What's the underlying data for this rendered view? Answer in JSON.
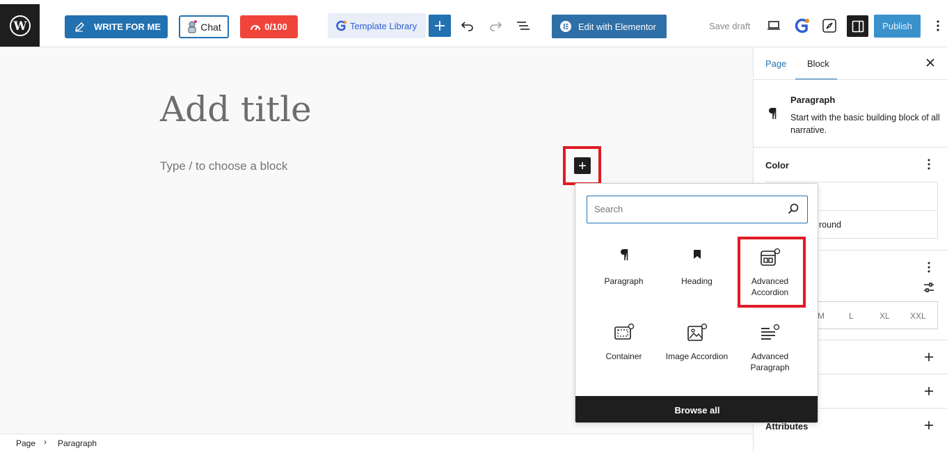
{
  "toolbar": {
    "write_label": "WRITE FOR ME",
    "chat_label": "Chat",
    "score_label": "0/100",
    "template_label": "Template Library",
    "elementor_label": "Edit with Elementor",
    "save_draft_label": "Save draft",
    "publish_label": "Publish"
  },
  "editor": {
    "title_placeholder": "Add title",
    "block_placeholder": "Type / to choose a block"
  },
  "inserter": {
    "search_placeholder": "Search",
    "blocks": [
      {
        "label": "Paragraph",
        "icon": "paragraph-icon"
      },
      {
        "label": "Heading",
        "icon": "bookmark-icon"
      },
      {
        "label": "Advanced Accordion",
        "icon": "accordion-icon"
      },
      {
        "label": "Container",
        "icon": "container-icon"
      },
      {
        "label": "Image Accordion",
        "icon": "image-accordion-icon"
      },
      {
        "label": "Advanced Paragraph",
        "icon": "advanced-paragraph-icon"
      }
    ],
    "browse_all_label": "Browse all"
  },
  "sidebar": {
    "tab_page": "Page",
    "tab_block": "Block",
    "block_name": "Paragraph",
    "block_description": "Start with the basic building block of all narrative.",
    "color_title": "Color",
    "color_background_fragment": "round",
    "sizes": [
      "M",
      "L",
      "XL",
      "XXL"
    ],
    "attributes_title": "Attributes"
  },
  "footer": {
    "crumb_page": "Page",
    "crumb_current": "Paragraph"
  },
  "colors": {
    "accent": "#2271b1",
    "highlight": "#e01b24",
    "score": "#f0443a"
  }
}
